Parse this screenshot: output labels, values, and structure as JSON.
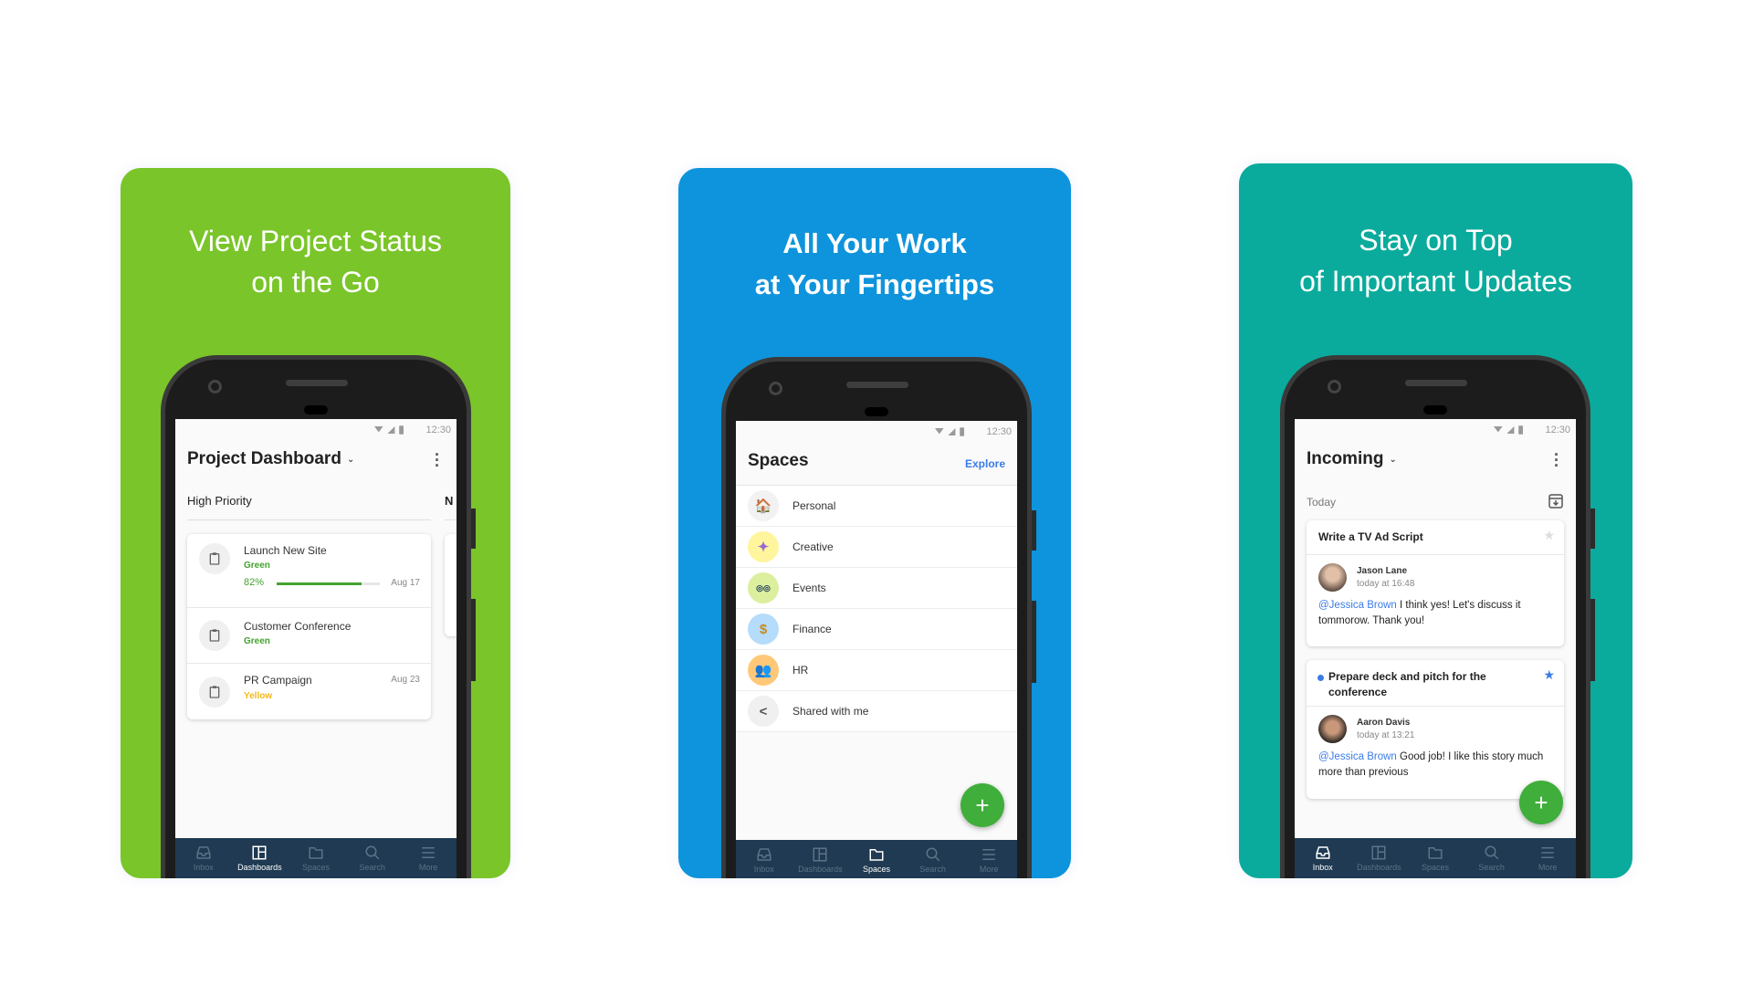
{
  "colors": {
    "panel1": "#7ac52a",
    "panel2": "#0e94dc",
    "panel3": "#0aab9c",
    "nav": "#1f3a52",
    "green": "#43a32f",
    "yellow": "#f3b716",
    "link": "#3b7be8",
    "fab": "#3fae3a"
  },
  "status_time": "12:30",
  "nav": [
    "Inbox",
    "Dashboards",
    "Spaces",
    "Search",
    "More"
  ],
  "panel1": {
    "title_line1": "View Project Status",
    "title_line2": "on the Go",
    "app_title": "Project Dashboard",
    "section": "High Priority",
    "next_section": "N",
    "items": [
      {
        "name": "Launch New Site",
        "status": "Green",
        "progress_label": "82%",
        "progress": 0.82,
        "date": "Aug 17"
      },
      {
        "name": "Customer Conference",
        "status": "Green"
      },
      {
        "name": "PR Campaign",
        "status": "Yellow",
        "date": "Aug 23"
      }
    ],
    "active_nav": "Dashboards"
  },
  "panel2": {
    "title_line1": "All Your Work",
    "title_line2": "at Your Fingertips",
    "app_title": "Spaces",
    "explore": "Explore",
    "items": [
      {
        "label": "Personal",
        "icon": "house-icon"
      },
      {
        "label": "Creative",
        "icon": "sparkles-icon"
      },
      {
        "label": "Events",
        "icon": "glasses-icon"
      },
      {
        "label": "Finance",
        "icon": "money-bag-icon"
      },
      {
        "label": "HR",
        "icon": "people-icon"
      },
      {
        "label": "Shared with me",
        "icon": "share-icon"
      }
    ],
    "active_nav": "Spaces"
  },
  "panel3": {
    "title_line1": "Stay on Top",
    "title_line2": "of Important Updates",
    "app_title": "Incoming",
    "section": "Today",
    "cards": [
      {
        "title": "Write a TV Ad Script",
        "starred": false,
        "unread": false,
        "author": "Jason Lane",
        "time": "today at 16:48",
        "mention": "@Jessica Brown",
        "message": " I think yes! Let's discuss it tommorow. Thank you!"
      },
      {
        "title": "Prepare deck and pitch for the conference",
        "starred": true,
        "unread": true,
        "author": "Aaron Davis",
        "time": "today at 13:21",
        "mention": "@Jessica Brown",
        "message": " Good job! I like this story much more than previous"
      }
    ],
    "active_nav": "Inbox"
  }
}
